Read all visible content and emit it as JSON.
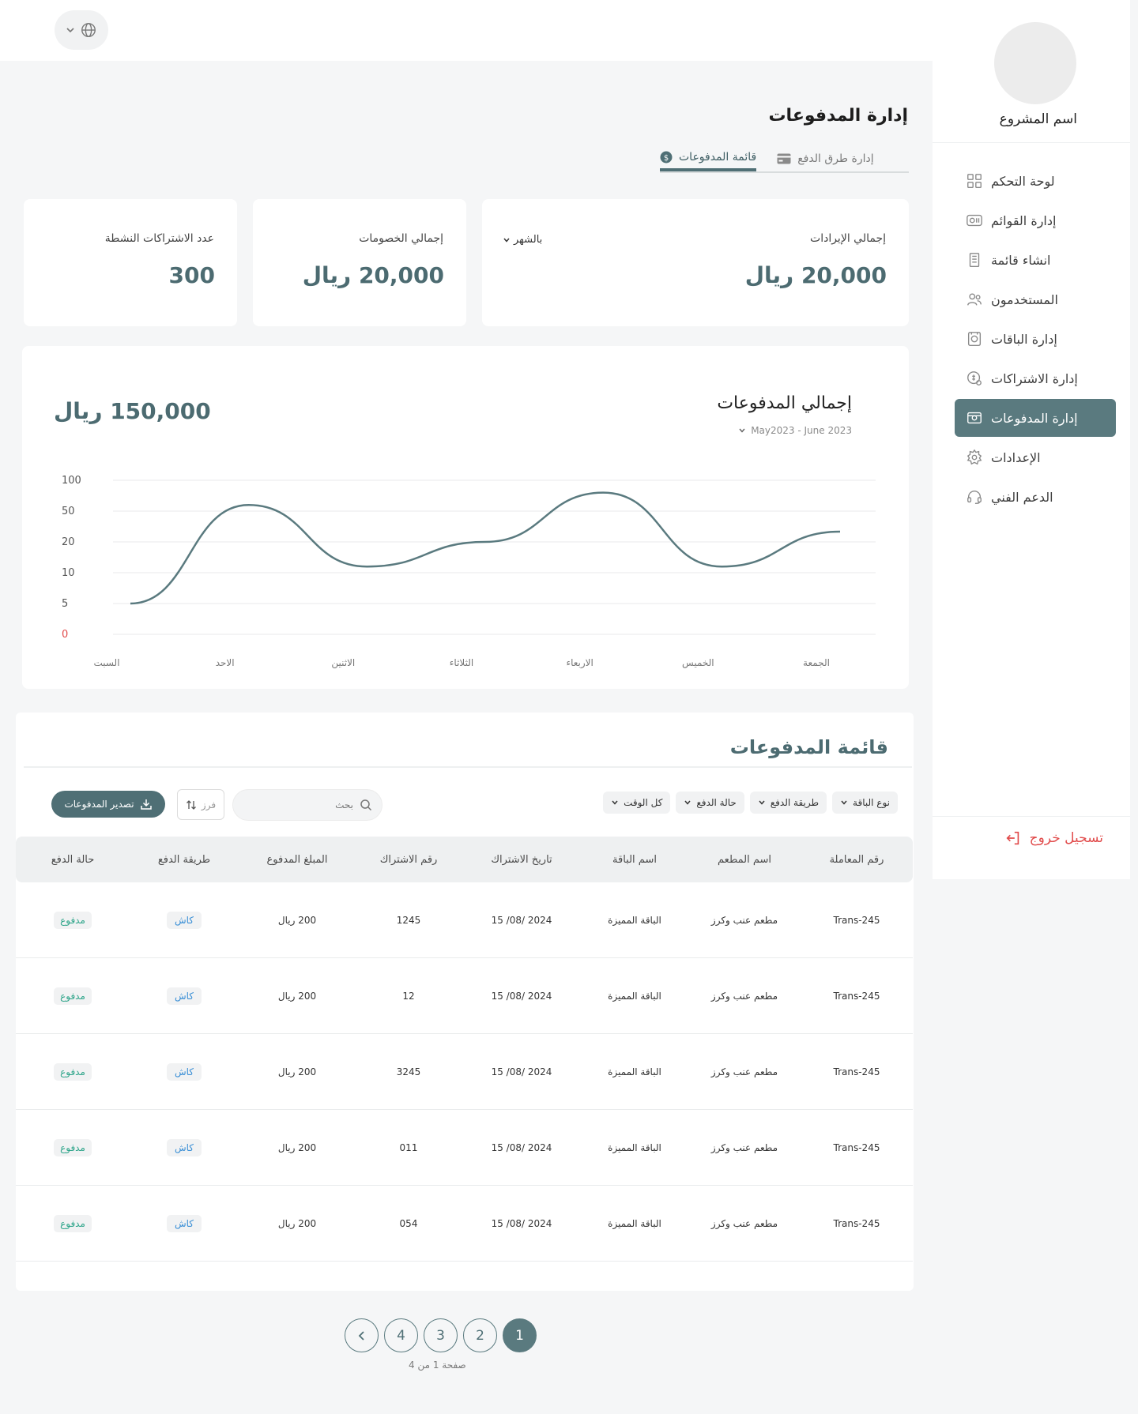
{
  "header": {
    "language_icon": "globe-icon"
  },
  "sidebar": {
    "project_name": "اسم المشروع",
    "items": [
      {
        "label": "لوحة التحكم",
        "icon": "grid-icon"
      },
      {
        "label": "إدارة القوائم",
        "icon": "menu-icon"
      },
      {
        "label": "انشاء قائمة",
        "icon": "list-icon"
      },
      {
        "label": "المستخدمون",
        "icon": "users-icon"
      },
      {
        "label": "إدارة الباقات",
        "icon": "package-icon"
      },
      {
        "label": "إدارة الاشتراكات",
        "icon": "subscription-icon"
      },
      {
        "label": "إدارة المدفوعات",
        "icon": "payments-icon"
      },
      {
        "label": "الإعدادات",
        "icon": "gear-icon"
      },
      {
        "label": "الدعم الفني",
        "icon": "headset-icon"
      }
    ],
    "active_index": 6,
    "logout_label": "تسجيل خروج"
  },
  "page": {
    "title": "إدارة المدفوعات",
    "tabs": [
      {
        "label": "قائمة المدفوعات",
        "icon": "dollar-icon"
      },
      {
        "label": "إدارة طرق الدفع",
        "icon": "card-icon"
      }
    ]
  },
  "stats": {
    "revenue": {
      "label": "إجمالي الإيرادات",
      "value": "20,000 ريال",
      "period": "بالشهر"
    },
    "discounts": {
      "label": "إجمالي الخصومات",
      "value": "20,000 ريال"
    },
    "subscriptions": {
      "label": "عدد الاشتراكات النشطة",
      "value": "300"
    }
  },
  "chart_card": {
    "title": "إجمالي المدفوعات",
    "range": "May2023 - June 2023",
    "total": "150,000 ريال"
  },
  "chart_data": {
    "type": "line",
    "categories": [
      "السبت",
      "الاحد",
      "الاثنين",
      "الثلاثاء",
      "الاربعاء",
      "الخميس",
      "الجمعة"
    ],
    "y_ticks": [
      "0",
      "5",
      "10",
      "20",
      "50",
      "100"
    ],
    "series": [
      {
        "values": [
          5,
          60,
          12,
          20,
          80,
          12,
          30
        ]
      }
    ],
    "grid": true,
    "line_color": "#5a7a7f"
  },
  "list": {
    "title": "قائمة المدفوعات",
    "filters": [
      "كل الوقت",
      "حالة الدفع",
      "طريقة الدفع",
      "نوع الباقة"
    ],
    "search_placeholder": "بحث",
    "sort_label": "فرز",
    "export_label": "تصدير المدفوعات",
    "columns": [
      "رقم المعاملة",
      "اسم المطعم",
      "اسم الباقة",
      "تاريخ الاشتراك",
      "رقم الاشتراك",
      "المبلغ المدفوع",
      "طريقة الدفع",
      "حالة الدفع"
    ],
    "rows": [
      [
        "Trans-245",
        "مطعم عنب وكرز",
        "الباقة المميزة",
        "15 /08/ 2024",
        "1245",
        "200 ريال",
        "كاش",
        "مدفوع"
      ],
      [
        "Trans-245",
        "مطعم عنب وكرز",
        "الباقة المميزة",
        "15 /08/ 2024",
        "12",
        "200 ريال",
        "كاش",
        "مدفوع"
      ],
      [
        "Trans-245",
        "مطعم عنب وكرز",
        "الباقة المميزة",
        "15 /08/ 2024",
        "3245",
        "200 ريال",
        "كاش",
        "مدفوع"
      ],
      [
        "Trans-245",
        "مطعم عنب وكرز",
        "الباقة المميزة",
        "15 /08/ 2024",
        "011",
        "200 ريال",
        "كاش",
        "مدفوع"
      ],
      [
        "Trans-245",
        "مطعم عنب وكرز",
        "الباقة المميزة",
        "15 /08/ 2024",
        "054",
        "200 ريال",
        "كاش",
        "مدفوع"
      ]
    ]
  },
  "pagination": {
    "pages": [
      "1",
      "2",
      "3",
      "4"
    ],
    "active": "1",
    "info": "صفحة 1 من 4"
  }
}
